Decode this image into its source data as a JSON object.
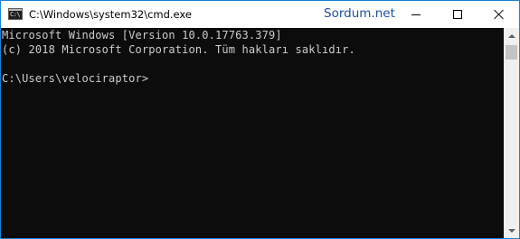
{
  "window": {
    "title": "C:\\Windows\\system32\\cmd.exe",
    "icon": "cmd-icon",
    "icon_glyph": "C:\\",
    "border_color": "#1883d7"
  },
  "watermark": "Sordum.net",
  "caption_buttons": {
    "minimize": "minimize-icon",
    "maximize": "maximize-icon",
    "close": "close-icon"
  },
  "console": {
    "background": "#0c0c0c",
    "foreground": "#cccccc",
    "lines": [
      "Microsoft Windows [Version 10.0.17763.379]",
      "(c) 2018 Microsoft Corporation. Tüm hakları saklıdır.",
      "C:\\Users\\velociraptor>"
    ]
  },
  "scrollbar": {
    "up_icon": "chevron-up-icon",
    "down_icon": "chevron-down-icon"
  }
}
